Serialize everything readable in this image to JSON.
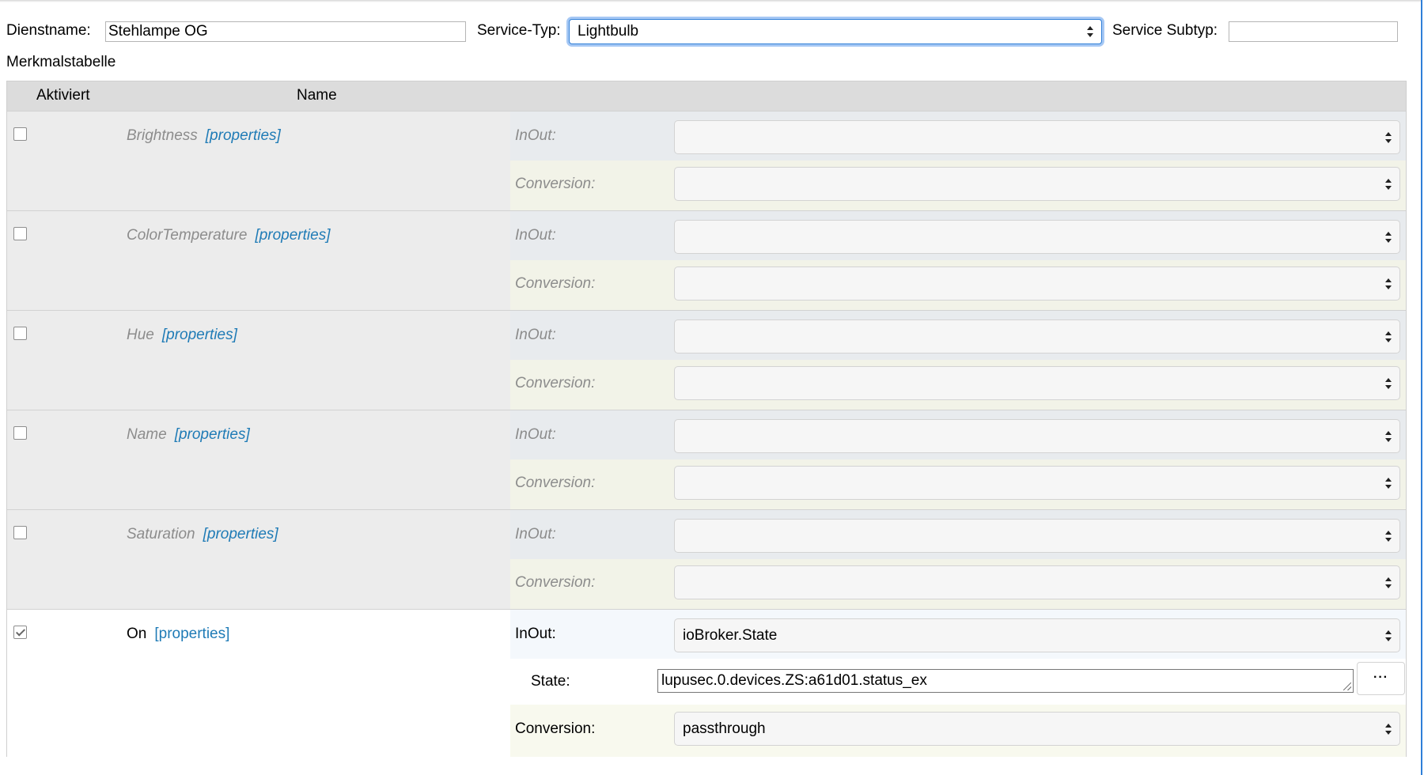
{
  "header": {
    "service_name_label": "Dienstname:",
    "service_name_value": "Stehlampe OG",
    "service_type_label": "Service-Typ:",
    "service_type_value": "Lightbulb",
    "service_subtype_label": "Service Subtyp:",
    "service_subtype_value": ""
  },
  "table": {
    "caption": "Merkmalstabelle",
    "col_enabled": "Aktiviert",
    "col_name": "Name",
    "properties_link": "[properties]",
    "rows": [
      {
        "name": "Brightness",
        "enabled": false,
        "inout_label": "InOut:",
        "inout_value": "",
        "conversion_label": "Conversion:",
        "conversion_value": ""
      },
      {
        "name": "ColorTemperature",
        "enabled": false,
        "inout_label": "InOut:",
        "inout_value": "",
        "conversion_label": "Conversion:",
        "conversion_value": ""
      },
      {
        "name": "Hue",
        "enabled": false,
        "inout_label": "InOut:",
        "inout_value": "",
        "conversion_label": "Conversion:",
        "conversion_value": ""
      },
      {
        "name": "Name",
        "enabled": false,
        "inout_label": "InOut:",
        "inout_value": "",
        "conversion_label": "Conversion:",
        "conversion_value": ""
      },
      {
        "name": "Saturation",
        "enabled": false,
        "inout_label": "InOut:",
        "inout_value": "",
        "conversion_label": "Conversion:",
        "conversion_value": ""
      },
      {
        "name": "On",
        "enabled": true,
        "inout_label": "InOut:",
        "inout_value": "ioBroker.State",
        "state_label": "State:",
        "state_value": "lupusec.0.devices.ZS:a61d01.status_ex",
        "state_button": "···",
        "conversion_label": "Conversion:",
        "conversion_value": "passthrough"
      }
    ]
  },
  "colors": {
    "header_bg": "#dcdcdc",
    "inactive_row_bg": "#ececec",
    "inout_bg": "#e8ebee",
    "conversion_bg": "#f2f3e8",
    "link": "#1f7bb6",
    "focus": "#2f7fd8"
  }
}
